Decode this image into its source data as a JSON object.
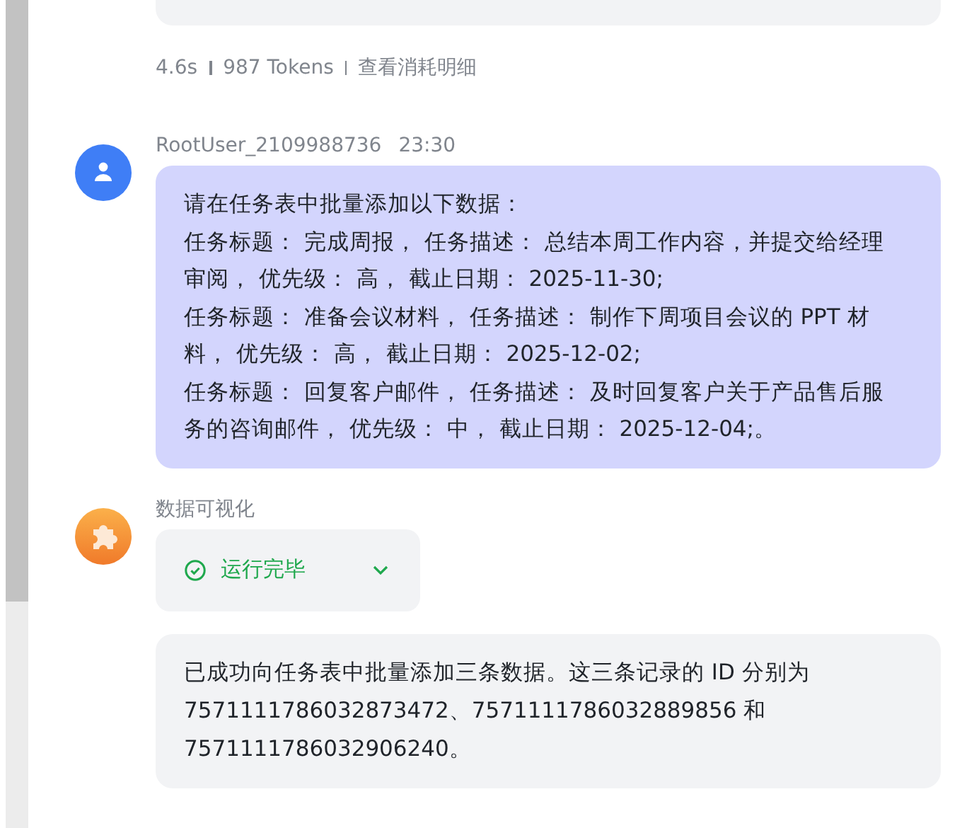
{
  "stats": {
    "duration": "4.6s",
    "tokens": "987 Tokens",
    "detail_link": "查看消耗明细"
  },
  "messages": [
    {
      "kind": "user",
      "author": "RootUser_2109988736",
      "time": "23:30",
      "paragraphs": [
        "请在任务表中批量添加以下数据：",
        "任务标题： 完成周报， 任务描述： 总结本周工作内容，并提交给经理审阅， 优先级： 高， 截止日期： 2025-11-30;",
        "任务标题： 准备会议材料， 任务描述： 制作下周项目会议的 PPT 材料， 优先级： 高， 截止日期： 2025-12-02;",
        "任务标题： 回复客户邮件， 任务描述： 及时回复客户关于产品售后服务的咨询邮件， 优先级： 中， 截止日期： 2025-12-04;。"
      ]
    },
    {
      "kind": "tool",
      "author": "数据可视化",
      "status": "运行完毕",
      "answer": "已成功向任务表中批量添加三条数据。这三条记录的 ID 分别为 7571111786032873472、7571111786032889856 和 7571111786032906240。"
    }
  ]
}
